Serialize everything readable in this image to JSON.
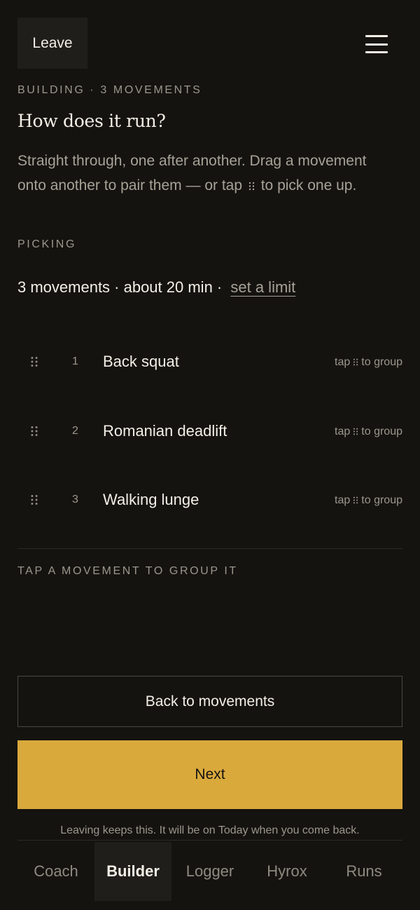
{
  "header": {
    "leave_label": "Leave",
    "menu_icon": "hamburger-menu-icon"
  },
  "eyebrow": "BUILDING · 3 MOVEMENTS",
  "title": "How does it run?",
  "intro": {
    "part1": "Straight through, one after another. Drag a movement onto another to pair them — or tap",
    "part2": "to pick one up."
  },
  "picking_label": "PICKING",
  "summary": {
    "text": "3 movements · about 20 min ·",
    "limit_link": "set a limit"
  },
  "movements": [
    {
      "index": "1",
      "name": "Back squat",
      "hint_prefix": "tap",
      "hint_suffix": "to group"
    },
    {
      "index": "2",
      "name": "Romanian deadlift",
      "hint_prefix": "tap",
      "hint_suffix": "to group"
    },
    {
      "index": "3",
      "name": "Walking lunge",
      "hint_prefix": "tap",
      "hint_suffix": "to group"
    }
  ],
  "group_caption": "TAP A MOVEMENT TO GROUP IT",
  "buttons": {
    "back": "Back to movements",
    "next": "Next"
  },
  "footnote": "Leaving keeps this. It will be on Today when you come back.",
  "tabs": [
    {
      "label": "Coach",
      "active": false
    },
    {
      "label": "Builder",
      "active": true
    },
    {
      "label": "Logger",
      "active": false
    },
    {
      "label": "Hyrox",
      "active": false
    },
    {
      "label": "Runs",
      "active": false
    }
  ],
  "colors": {
    "background": "#141310",
    "accent": "#daa93c",
    "text": "#f3efe6",
    "muted": "#9c978c"
  }
}
